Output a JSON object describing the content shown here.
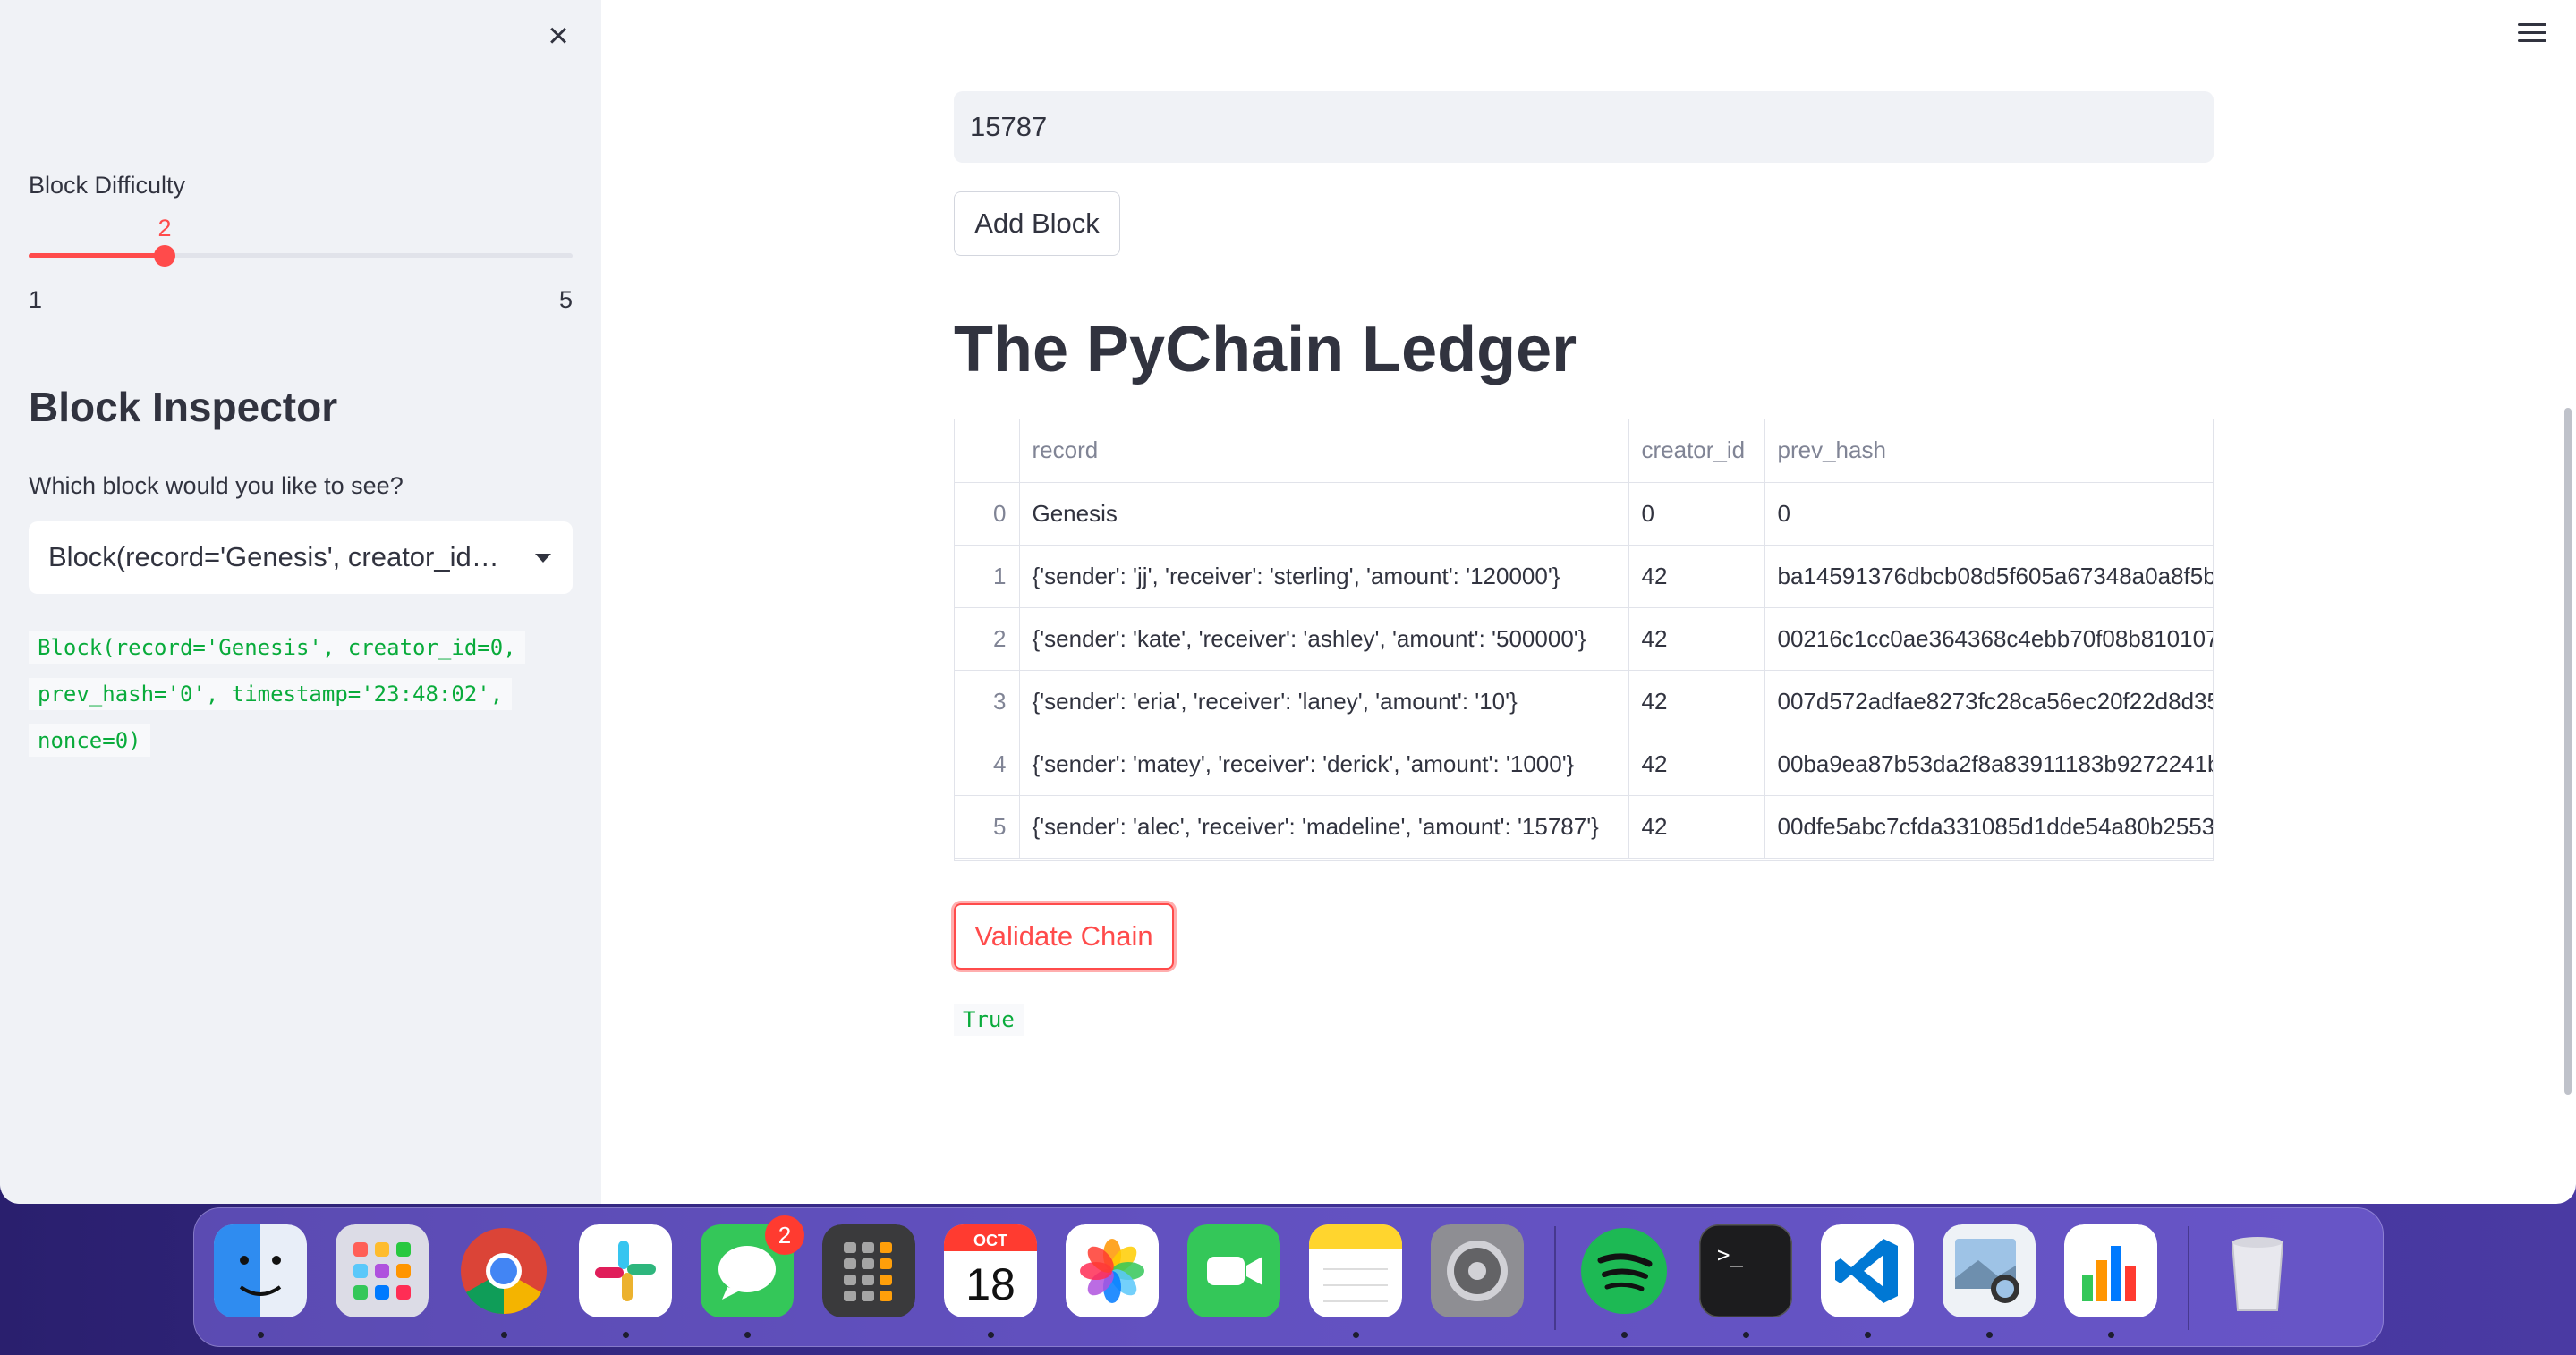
{
  "sidebar": {
    "close_icon": "close-icon",
    "difficulty": {
      "label": "Block Difficulty",
      "value": "2",
      "min": "1",
      "max": "5",
      "value_fraction": 0.25,
      "accent": "#ff4b4b"
    },
    "inspector": {
      "title": "Block Inspector",
      "question": "Which block would you like to see?",
      "selected": "Block(record='Genesis', creator_id=0, prev_hash='0', timestamp='23:48:02', nonce=0)",
      "code_lines": [
        "Block(record='Genesis', creator_id=0,",
        "prev_hash='0', timestamp='23:48:02',",
        "nonce=0)"
      ]
    }
  },
  "header": {
    "menu_icon": "hamburger-menu-icon"
  },
  "main": {
    "amount_value": "15787",
    "add_block_label": "Add Block",
    "ledger_title": "The PyChain Ledger",
    "table": {
      "columns": [
        "",
        "record",
        "creator_id",
        "prev_hash"
      ],
      "rows": [
        {
          "index": "0",
          "record": "Genesis",
          "creator_id": "0",
          "prev_hash": "0"
        },
        {
          "index": "1",
          "record": "{'sender': 'jj', 'receiver': 'sterling', 'amount': '120000'}",
          "creator_id": "42",
          "prev_hash": "ba14591376dbcb08d5f605a67348a0a8f5b"
        },
        {
          "index": "2",
          "record": "{'sender': 'kate', 'receiver': 'ashley', 'amount': '500000'}",
          "creator_id": "42",
          "prev_hash": "00216c1cc0ae364368c4ebb70f08b810107"
        },
        {
          "index": "3",
          "record": "{'sender': 'eria', 'receiver': 'laney', 'amount': '10'}",
          "creator_id": "42",
          "prev_hash": "007d572adfae8273fc28ca56ec20f22d8d35"
        },
        {
          "index": "4",
          "record": "{'sender': 'matey', 'receiver': 'derick', 'amount': '1000'}",
          "creator_id": "42",
          "prev_hash": "00ba9ea87b53da2f8a83911183b9272241b"
        },
        {
          "index": "5",
          "record": "{'sender': 'alec', 'receiver': 'madeline', 'amount': '15787'}",
          "creator_id": "42",
          "prev_hash": "00dfe5abc7cfda331085d1dde54a80b2553"
        }
      ]
    },
    "validate_label": "Validate Chain",
    "validate_result": "True"
  },
  "dock": {
    "apps": [
      {
        "name": "finder",
        "icon": "finder-icon",
        "color": "#2f8cf0",
        "running": true
      },
      {
        "name": "launchpad",
        "icon": "launchpad-icon",
        "color": "#d9d9e3",
        "running": false
      },
      {
        "name": "chrome",
        "icon": "chrome-icon",
        "color": "#ffffff",
        "running": true
      },
      {
        "name": "slack",
        "icon": "slack-icon",
        "color": "#ffffff",
        "running": true
      },
      {
        "name": "messages",
        "icon": "messages-icon",
        "color": "#34c759",
        "running": true,
        "badge": "2"
      },
      {
        "name": "calculator",
        "icon": "calculator-icon",
        "color": "#3a3a3c",
        "running": false
      },
      {
        "name": "calendar",
        "icon": "calendar-icon",
        "color": "#ffffff",
        "running": true,
        "month": "OCT",
        "day": "18"
      },
      {
        "name": "photos",
        "icon": "photos-icon",
        "color": "#ffffff",
        "running": false
      },
      {
        "name": "facetime",
        "icon": "facetime-icon",
        "color": "#34c759",
        "running": false
      },
      {
        "name": "notes",
        "icon": "notes-icon",
        "color": "#ffd52e",
        "running": true
      },
      {
        "name": "system-settings",
        "icon": "gear-icon",
        "color": "#8e8e93",
        "running": false
      },
      {
        "name": "spotify",
        "icon": "spotify-icon",
        "color": "#1db954",
        "running": true
      },
      {
        "name": "terminal",
        "icon": "terminal-icon",
        "color": "#1c1c1e",
        "running": true
      },
      {
        "name": "vscode",
        "icon": "vscode-icon",
        "color": "#ffffff",
        "running": true
      },
      {
        "name": "preview",
        "icon": "preview-icon",
        "color": "#9ec3e6",
        "running": true
      },
      {
        "name": "numbers",
        "icon": "numbers-icon",
        "color": "#ffffff",
        "running": true
      },
      {
        "name": "trash",
        "icon": "trash-icon",
        "color": "#e8e8ee",
        "running": false
      }
    ]
  }
}
